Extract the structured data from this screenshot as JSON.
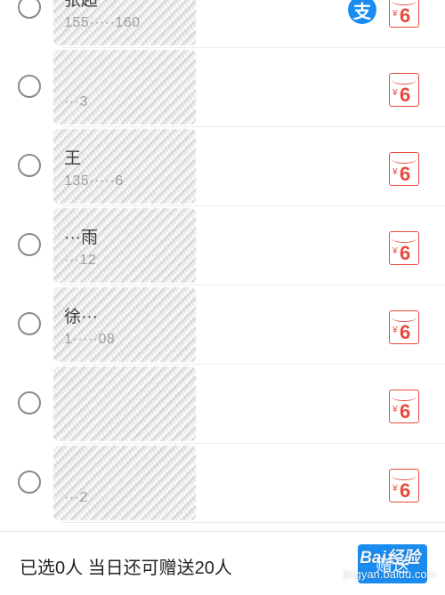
{
  "contacts": [
    {
      "name": "张超",
      "phone": "155·····160",
      "show_alipay": true,
      "amount": "6"
    },
    {
      "name": "",
      "phone": "···3",
      "show_alipay": false,
      "amount": "6"
    },
    {
      "name": "王",
      "phone": "135·····6",
      "show_alipay": false,
      "amount": "6"
    },
    {
      "name": "···雨",
      "phone": "···12",
      "show_alipay": false,
      "amount": "6"
    },
    {
      "name": "徐···",
      "phone": "1·····08",
      "show_alipay": false,
      "amount": "6"
    },
    {
      "name": "",
      "phone": "",
      "show_alipay": false,
      "amount": "6"
    },
    {
      "name": "",
      "phone": "···2",
      "show_alipay": false,
      "amount": "6"
    }
  ],
  "icons": {
    "alipay": "支",
    "currency": "¥"
  },
  "footer": {
    "summary": "已选0人 当日还可赠送20人",
    "send_label": "赠送"
  },
  "watermark": {
    "logo": "Bai经验",
    "url": "jingyan.baidu.com"
  },
  "colors": {
    "accent": "#1a8cf0",
    "envelope": "#e8493b"
  }
}
